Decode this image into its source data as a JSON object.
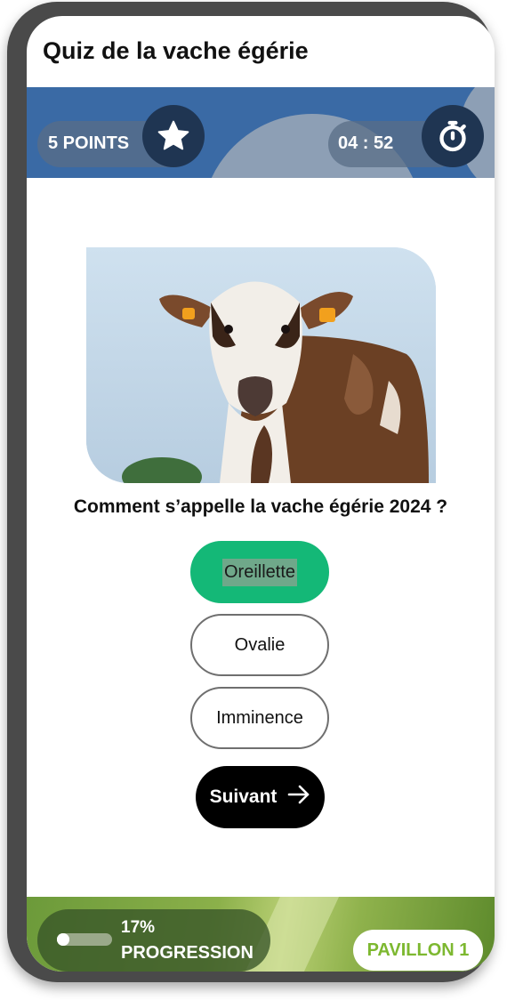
{
  "app": {
    "title": "Quiz de la vache égérie"
  },
  "header": {
    "points_label": "5 POINTS",
    "timer_label": "04 : 52",
    "star_icon": "star-icon",
    "timer_icon": "stopwatch-icon"
  },
  "question": {
    "image_icon": "cow-photo",
    "text": "Comment s’appelle la vache égérie 2024 ?"
  },
  "answers": [
    {
      "label": "Oreillette",
      "selected": true
    },
    {
      "label": "Ovalie",
      "selected": false
    },
    {
      "label": "Imminence",
      "selected": false
    }
  ],
  "next_button": {
    "label": "Suivant",
    "icon": "arrow-right-icon"
  },
  "footer": {
    "progress_percent_label": "17%",
    "progress_value": 0.17,
    "progress_label": "PROGRESSION",
    "pavillon_label": "PAVILLON 1"
  },
  "colors": {
    "accent_green": "#14b877",
    "banner_blue": "#3a6aa5",
    "pavillon_green": "#7db830"
  }
}
